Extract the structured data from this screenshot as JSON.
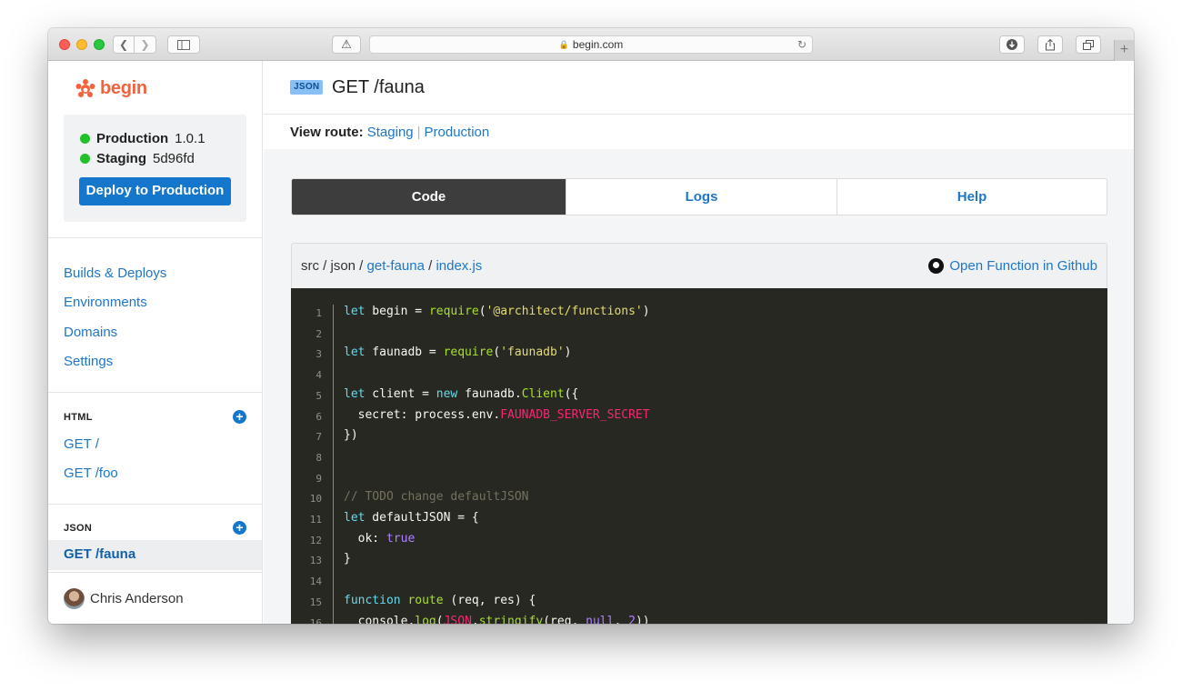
{
  "browser": {
    "url": "begin.com"
  },
  "sidebar": {
    "logo_text": "begin",
    "environments": [
      {
        "name": "Production",
        "version": "1.0.1",
        "status_color": "#22c02c"
      },
      {
        "name": "Staging",
        "version": "5d96fd",
        "status_color": "#22c02c"
      }
    ],
    "deploy_label": "Deploy to Production",
    "nav": [
      "Builds & Deploys",
      "Environments",
      "Domains",
      "Settings"
    ],
    "html_section": {
      "heading": "HTML",
      "routes": [
        "GET /",
        "GET /foo"
      ]
    },
    "json_section": {
      "heading": "JSON",
      "routes": [
        "GET /fauna"
      ]
    },
    "user_name": "Chris Anderson"
  },
  "main": {
    "type_badge": "JSON",
    "route_title": "GET /fauna",
    "view_route_label": "View route:",
    "view_route_links": [
      "Staging",
      "Production"
    ],
    "tabs": [
      "Code",
      "Logs",
      "Help"
    ],
    "active_tab": "Code",
    "path": {
      "prefix": "src / json / ",
      "folder": "get-fauna",
      "sep": " / ",
      "file": "index.js"
    },
    "github_link": "Open Function in Github"
  },
  "code_lines": [
    {
      "n": "1",
      "t": "let begin = require('@architect/functions')"
    },
    {
      "n": "2",
      "t": ""
    },
    {
      "n": "3",
      "t": "let faunadb = require('faunadb')"
    },
    {
      "n": "4",
      "t": ""
    },
    {
      "n": "5",
      "t": "let client = new faunadb.Client({"
    },
    {
      "n": "6",
      "t": "  secret: process.env.FAUNADB_SERVER_SECRET"
    },
    {
      "n": "7",
      "t": "})"
    },
    {
      "n": "8",
      "t": ""
    },
    {
      "n": "9",
      "t": ""
    },
    {
      "n": "10",
      "t": "// TODO change defaultJSON"
    },
    {
      "n": "11",
      "t": "let defaultJSON = {"
    },
    {
      "n": "12",
      "t": "  ok: true"
    },
    {
      "n": "13",
      "t": "}"
    },
    {
      "n": "14",
      "t": ""
    },
    {
      "n": "15",
      "t": "function route (req, res) {"
    },
    {
      "n": "16",
      "t": "  console.log(JSON.stringify(req, null, 2))"
    }
  ],
  "colors": {
    "accent": "#1477cc",
    "brand": "#f1623d",
    "code_bg": "#272822"
  }
}
